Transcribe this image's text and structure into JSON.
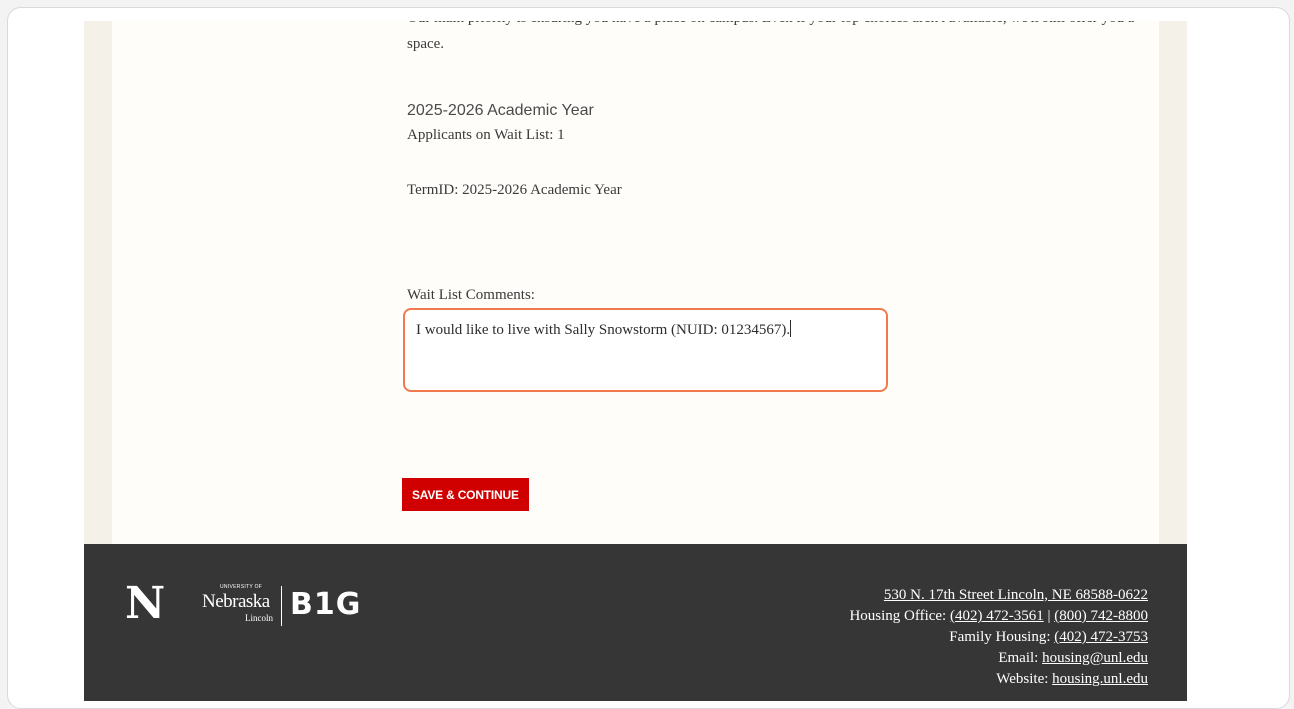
{
  "main": {
    "intro_text": "Our main priority is ensuring you have a place on campus. Even if your top choices aren't available, we'll still offer you a space.",
    "year_heading": "2025-2026 Academic Year",
    "applicants_on_wait_list": "Applicants on Wait List: 1",
    "term_id": "TermID: 2025-2026 Academic Year",
    "comments_label": "Wait List Comments:",
    "comments_value": "I would like to live with Sally Snowstorm (NUID: 01234567).",
    "save_label": "SAVE & CONTINUE"
  },
  "footer": {
    "logos": {
      "n_mark": "N",
      "nebraska_university": "UNIVERSITY OF",
      "nebraska_word": "Nebraska",
      "nebraska_city": "Lincoln",
      "big": "B1G"
    },
    "address": "530 N. 17th Street Lincoln, NE 68588-0622",
    "housing_office_label": "Housing Office: ",
    "housing_phone_1": "(402) 472-3561",
    "phone_separator": " | ",
    "housing_phone_2": "(800) 742-8800",
    "family_housing_label": "Family Housing: ",
    "family_phone": "(402) 472-3753",
    "email_label": "Email: ",
    "email": "housing@unl.edu",
    "website_label": "Website: ",
    "website": "housing.unl.edu"
  },
  "colors": {
    "accent_red": "#d00000",
    "focus_orange": "#f07a4e",
    "footer_bg": "#363636",
    "page_bg": "#f4f1e9"
  }
}
